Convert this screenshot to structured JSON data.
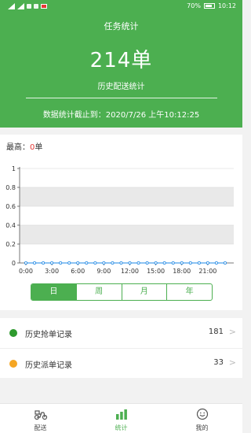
{
  "status_bar": {
    "battery": "70%",
    "time": "10:12"
  },
  "header": {
    "title": "任务统计",
    "total": "214单",
    "subtitle": "历史配送统计",
    "deadline": "数据统计截止到：2020/7/26 上午10:12:25"
  },
  "chart": {
    "max_label": "最高：",
    "max_value": "0",
    "max_unit": "单"
  },
  "chart_data": {
    "type": "line",
    "x": [
      "0:00",
      "1:00",
      "2:00",
      "3:00",
      "4:00",
      "5:00",
      "6:00",
      "7:00",
      "8:00",
      "9:00",
      "10:00",
      "11:00",
      "12:00",
      "13:00",
      "14:00",
      "15:00",
      "16:00",
      "17:00",
      "18:00",
      "19:00",
      "20:00",
      "21:00",
      "22:00",
      "23:00"
    ],
    "xticks": [
      "0:00",
      "3:00",
      "6:00",
      "9:00",
      "12:00",
      "15:00",
      "18:00",
      "21:00"
    ],
    "series": [
      {
        "values": [
          0,
          0,
          0,
          0,
          0,
          0,
          0,
          0,
          0,
          0,
          0,
          0,
          0,
          0,
          0,
          0,
          0,
          0,
          0,
          0,
          0,
          0,
          0,
          0
        ]
      }
    ],
    "yticks": [
      "0",
      "0.2",
      "0.4",
      "0.6",
      "0.8",
      "1"
    ],
    "ylim": [
      0,
      1
    ],
    "grid": true,
    "line_color": "#1e88e5"
  },
  "segmented": [
    "日",
    "周",
    "月",
    "年"
  ],
  "records": [
    {
      "label": "历史抢单记录",
      "count": "181",
      "color": "#2e9a2e"
    },
    {
      "label": "历史派单记录",
      "count": "33",
      "color": "#f5a623"
    }
  ],
  "tabs": [
    {
      "label": "配送",
      "icon": "scooter-icon"
    },
    {
      "label": "统计",
      "icon": "bar-chart-icon"
    },
    {
      "label": "我的",
      "icon": "profile-icon"
    }
  ],
  "colors": {
    "brand": "#4caf50"
  }
}
